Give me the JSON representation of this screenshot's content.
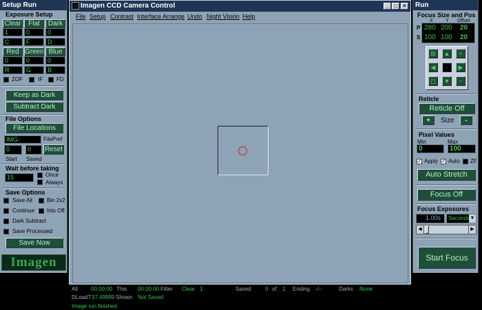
{
  "left": {
    "title": "Setup Run",
    "exposure_setup": "Exposure Setup",
    "filters": [
      "Clear",
      "Flat",
      "Dark"
    ],
    "filter_vals": [
      "1",
      "0",
      "0"
    ],
    "filter_letters": [
      "C",
      "F",
      "D"
    ],
    "colors": [
      "Red",
      "Green",
      "Blue"
    ],
    "color_vals": [
      "0",
      "0",
      "0"
    ],
    "color_letters": [
      "R",
      "G",
      "B"
    ],
    "cb_labels": [
      "ZOF",
      "IF",
      "FD"
    ],
    "keep_dark": "Keep as Dark",
    "subtract_dark": "Subtract Dark",
    "file_options": "File Options",
    "file_locations": "File Locations",
    "file_prefix_value": "IMG-",
    "file_prefix_label": "FilePref",
    "start_value": "0",
    "saved_value": "0",
    "reset": "Reset",
    "start_label": "Start",
    "saved_label": "Saved",
    "wait_label": "Wait before taking",
    "wait_value": "15",
    "once_label": "Once",
    "always_label": "Always",
    "save_options": "Save Options",
    "save_all": "Save All",
    "bin": "Bin 2x2",
    "continue": "Continue",
    "ints_off": "Ints Off",
    "dark_subtract": "Dark Subtract",
    "save_processed": "Save Processed",
    "save_now": "Save Now",
    "logo": "Imagen"
  },
  "window": {
    "title": "Imagen CCD Camera Control",
    "menus": [
      "File",
      "Setup",
      "Contrast",
      "Interface Arrange",
      "Undo",
      "Night Vision",
      "Help"
    ],
    "min": "_",
    "max": "□",
    "close": "×"
  },
  "right": {
    "title": "Run",
    "focus_size_pos": "Focus Size and Pos",
    "x_label": "X",
    "y_label": "Y",
    "offset_label": "Offset",
    "p_label": "P",
    "s_label": "S",
    "p_x": "280",
    "p_y": "200",
    "p_off": "20",
    "s_x": "100",
    "s_y": "100",
    "s_off": "20",
    "reticle": "Reticle",
    "reticle_off": "Reticle Off",
    "plus": "+",
    "minus": "-",
    "size": "Size",
    "pixel_values": "Pixel Values",
    "min_label": "Min",
    "max_label": "Max",
    "min_value": "0",
    "max_value": "100",
    "apply": "Apply",
    "auto": "Auto",
    "zf": "ZF",
    "auto_stretch": "Auto Stretch",
    "focus_off": "Focus Off",
    "focus_exposures": "Focus Exposures",
    "exposure_value": "1.00s",
    "units": "Seconds",
    "start_focus": "Start Focus"
  },
  "status": {
    "all_label": "All",
    "all_time": "00:00:00",
    "this_label": "This",
    "this_time": "00:00:00",
    "filter_label": "Filter",
    "filter_value": "Clear",
    "filter_num": "1",
    "saved_label": "Saved",
    "saved_value": "0",
    "of_label": "of",
    "of_value": "1",
    "ending_label": "Ending",
    "ending_value": "-/--",
    "darks_label": "Darks",
    "darks_value": "None",
    "dload_label": "DLoadT",
    "dload_value": "37.49999",
    "shown_label": "Shown",
    "shown_value": "Not Saved",
    "message": "Image run finished"
  }
}
